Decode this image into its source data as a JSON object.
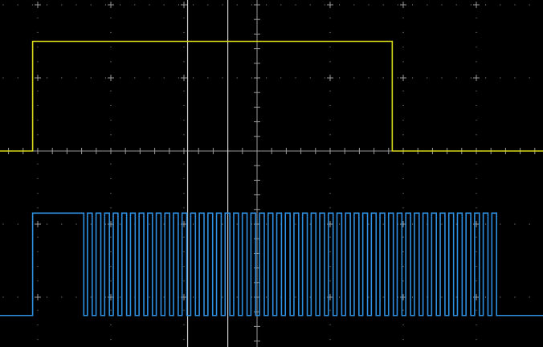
{
  "chart_data": {
    "type": "line",
    "title": "",
    "xlabel": "",
    "ylabel": "",
    "grid": true,
    "x_divisions": 7.5,
    "y_divisions": 4.8,
    "cursors": [
      {
        "type": "vertical",
        "x_div": -0.95
      },
      {
        "type": "vertical",
        "x_div": -0.4
      }
    ],
    "series": [
      {
        "color": "#d8d81a",
        "kind": "pulse",
        "baseline_div": 0,
        "high_div": 1.5,
        "rise_div": -3.07,
        "fall_div": 1.85
      },
      {
        "color": "#2f8fe0",
        "kind": "pulse_train",
        "baseline_div": -2.25,
        "high_div": -0.85,
        "first_pulse_start_div": -3.07,
        "first_pulse_end_div": -2.37,
        "train_start_div": -2.32,
        "train_end_div": 3.33,
        "pulse_count": 48,
        "duty": 0.55
      }
    ],
    "colors": {
      "grid": "#9a9a9a",
      "cursor": "#d0d0d0",
      "background": "#000000"
    }
  }
}
